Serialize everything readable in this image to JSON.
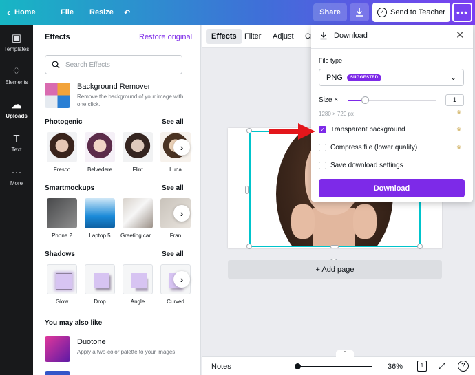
{
  "topbar": {
    "home_label": "Home",
    "file_label": "File",
    "resize_label": "Resize",
    "undo_icon": "undo-icon",
    "share_label": "Share",
    "download_icon": "download-icon",
    "send_teacher_label": "Send to Teacher",
    "more_label": "•••"
  },
  "rail": {
    "items": [
      {
        "label": "Templates",
        "icon": "templates-icon"
      },
      {
        "label": "Elements",
        "icon": "elements-icon"
      },
      {
        "label": "Uploads",
        "icon": "uploads-icon"
      },
      {
        "label": "Text",
        "icon": "text-icon"
      },
      {
        "label": "More",
        "icon": "more-icon"
      }
    ]
  },
  "effects_panel": {
    "title": "Effects",
    "restore_label": "Restore original",
    "search_placeholder": "Search Effects",
    "bg_remover": {
      "title": "Background Remover",
      "desc": "Remove the background of your image with one click."
    },
    "photogenic": {
      "heading": "Photogenic",
      "see_all": "See all",
      "items": [
        "Fresco",
        "Belvedere",
        "Flint",
        "Luna"
      ]
    },
    "smartmockups": {
      "heading": "Smartmockups",
      "see_all": "See all",
      "items": [
        "Phone 2",
        "Laptop 5",
        "Greeting car...",
        "Fran"
      ]
    },
    "shadows": {
      "heading": "Shadows",
      "see_all": "See all",
      "items": [
        "Glow",
        "Drop",
        "Angle",
        "Curved"
      ]
    },
    "you_may_like": {
      "heading": "You may also like",
      "duotone_title": "Duotone",
      "duotone_desc": "Apply a two-color palette to your images."
    }
  },
  "toolbar_tabs": {
    "effects": "Effects",
    "filter": "Filter",
    "adjust": "Adjust",
    "crop": "Cr"
  },
  "canvas": {
    "add_page": "+ Add page"
  },
  "bottombar": {
    "notes": "Notes",
    "zoom": "36%",
    "page_count": "1",
    "help": "?",
    "zoom_fraction": 0.02
  },
  "download_panel": {
    "title": "Download",
    "file_type_label": "File type",
    "file_type_value": "PNG",
    "suggested_badge": "SUGGESTED",
    "size_label": "Size ×",
    "size_value": "1",
    "size_fraction": 0.18,
    "dimensions": "1280 × 720 px",
    "transparent_label": "Transparent background",
    "transparent_checked": true,
    "compress_label": "Compress file (lower quality)",
    "compress_checked": false,
    "save_settings_label": "Save download settings",
    "save_settings_checked": false,
    "download_button": "Download"
  },
  "colors": {
    "accent": "#7d2ae8",
    "selection": "#00c4cc",
    "arrow": "#e3161b"
  }
}
